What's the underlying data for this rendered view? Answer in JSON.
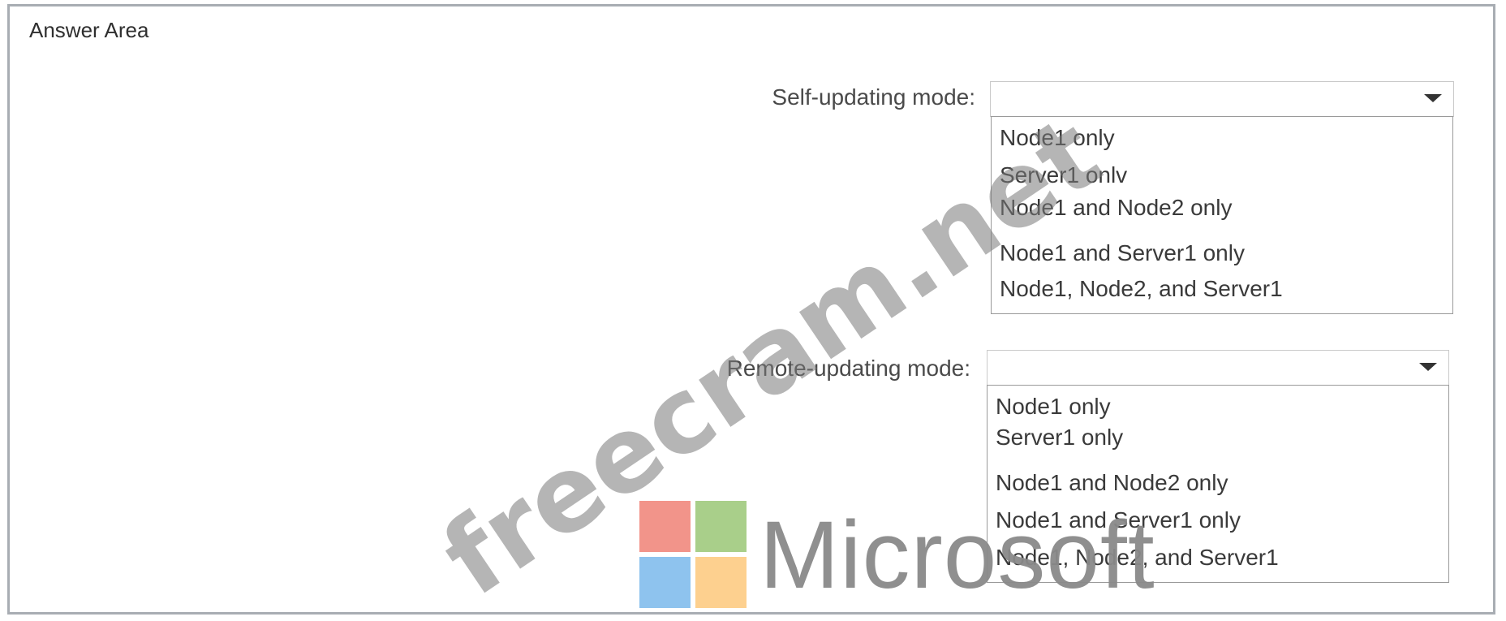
{
  "answer_area": {
    "title": "Answer Area"
  },
  "self_updating": {
    "label": "Self-updating mode:",
    "selected_value": "",
    "options": [
      "Node1 only",
      "Server1 onlv",
      "Node1 and Node2 only",
      "Node1 and Server1 only",
      "Node1, Node2, and Server1"
    ]
  },
  "remote_updating": {
    "label": "Remote-updating mode:",
    "selected_value": "",
    "options": [
      "Node1 only",
      "Server1 only",
      "Node1 and Node2 only",
      "Node1 and Server1 only",
      "Node1, Node2, and Server1"
    ]
  },
  "watermark": {
    "text": "freecram.net"
  },
  "logo": {
    "wordmark": "Microsoft",
    "colors": [
      "#f2948a",
      "#a9cf8a",
      "#8ec3ee",
      "#fdd08f"
    ]
  },
  "icons": {
    "dropdown_arrow": "chevron-down-icon"
  }
}
